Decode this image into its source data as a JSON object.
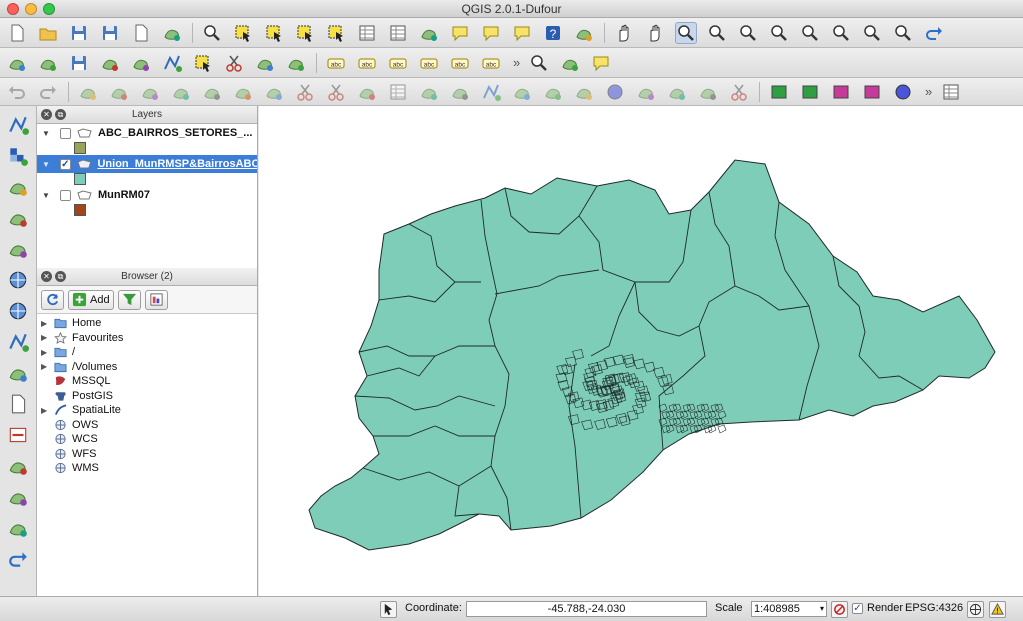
{
  "window": {
    "title": "QGIS 2.0.1-Dufour"
  },
  "toolbar1": {
    "icons": [
      "new-project-icon",
      "open-project-icon",
      "save-project-icon",
      "save-as-icon",
      "new-print-composer-icon",
      "composer-manager-icon",
      "identify-icon",
      "select-tool-icon",
      "select-features-icon",
      "deselect-icon",
      "expression-select-icon",
      "attribute-table-icon",
      "statistics-icon",
      "measure-icon",
      "annotation-icon",
      "text-annotation-icon",
      "form-annotation-icon",
      "help-icon",
      "whats-this-icon",
      "pan-icon",
      "pan-to-selection-icon",
      "zoom-in-icon",
      "zoom-out-icon",
      "zoom-actual-icon",
      "zoom-full-icon",
      "zoom-to-selection-icon",
      "zoom-to-layer-icon",
      "zoom-last-icon",
      "zoom-next-icon",
      "refresh-icon"
    ]
  },
  "toolbar2": {
    "icons": [
      "current-edits-icon",
      "toggle-editing-icon",
      "save-edits-icon",
      "add-feature-icon",
      "move-feature-icon",
      "node-tool-icon",
      "delete-selected-icon",
      "cut-features-icon",
      "copy-features-icon",
      "paste-features-icon",
      "label-icon",
      "pin-labels-icon",
      "show-hide-labels-icon",
      "move-label-icon",
      "rotate-label-icon",
      "change-label-icon",
      "binoculars-icon",
      "plugin-icon",
      "sticky-note-icon"
    ],
    "more": "»"
  },
  "toolbar3": {
    "icons": [
      "undo-icon",
      "redo-icon",
      "simplify-icon",
      "add-ring-icon",
      "add-part-icon",
      "delete-ring-icon",
      "delete-part-icon",
      "reshape-icon",
      "offset-curve-icon",
      "split-icon",
      "split-parts-icon",
      "merge-features-icon",
      "merge-attributes-icon",
      "rotate-point-icon",
      "rotate-feature-icon",
      "node-digitize-icon",
      "advanced-digitize-icon",
      "vertex-add-icon",
      "vertex-icon",
      "circle-icon",
      "fill-ring-icon",
      "trim-icon",
      "extend-icon",
      "split-lines-icon",
      "rect-icon",
      "rect-center-icon",
      "rect-extent-icon",
      "polygon-icon",
      "circle-select-icon",
      "layout-icon"
    ],
    "more": "»"
  },
  "left_toolbar": {
    "icons": [
      "add-vector-layer-icon",
      "add-raster-layer-icon",
      "add-postgis-layer-icon",
      "add-spatialite-layer-icon",
      "add-mssql-layer-icon",
      "add-wms-layer-icon",
      "add-wcs-layer-icon",
      "add-wfs-layer-icon",
      "add-delimited-text-icon",
      "new-shapefile-icon",
      "remove-layer-icon",
      "georeferencer-icon",
      "coordinate-capture-icon",
      "add-virtual-layer-icon",
      "refresh-layer-icon"
    ]
  },
  "layers_panel": {
    "title": "Layers",
    "items": [
      {
        "name": "ABC_BAIRROS_SETORES_...",
        "checked": false,
        "selected": false,
        "color": "#9aa35a"
      },
      {
        "name": "Union_MunRMSP&BairrosABC",
        "checked": true,
        "selected": true,
        "color": "#7ecdb8"
      },
      {
        "name": "MunRM07",
        "checked": false,
        "selected": false,
        "color": "#a0461a"
      }
    ]
  },
  "browser_panel": {
    "title": "Browser (2)",
    "add_label": "Add",
    "items": [
      {
        "label": "Home",
        "icon": "home-folder-icon",
        "expandable": true
      },
      {
        "label": "Favourites",
        "icon": "star-icon",
        "expandable": true
      },
      {
        "label": "/",
        "icon": "folder-icon",
        "expandable": true
      },
      {
        "label": "/Volumes",
        "icon": "folder-icon",
        "expandable": true
      },
      {
        "label": "MSSQL",
        "icon": "mssql-icon",
        "expandable": false
      },
      {
        "label": "PostGIS",
        "icon": "postgis-icon",
        "expandable": false
      },
      {
        "label": "SpatiaLite",
        "icon": "spatialite-icon",
        "expandable": true
      },
      {
        "label": "OWS",
        "icon": "ows-icon",
        "expandable": false
      },
      {
        "label": "WCS",
        "icon": "wcs-icon",
        "expandable": false
      },
      {
        "label": "WFS",
        "icon": "wfs-icon",
        "expandable": false
      },
      {
        "label": "WMS",
        "icon": "wms-icon",
        "expandable": false
      }
    ]
  },
  "map": {
    "fill_color": "#7ecdb8",
    "stroke_color": "#1f2a27"
  },
  "statusbar": {
    "coordinate_label": "Coordinate:",
    "coordinate_value": "-45.788,-24.030",
    "scale_label": "Scale",
    "scale_value": "1:408985",
    "render_label": "Render",
    "render_checked": true,
    "crs": "EPSG:4326"
  }
}
